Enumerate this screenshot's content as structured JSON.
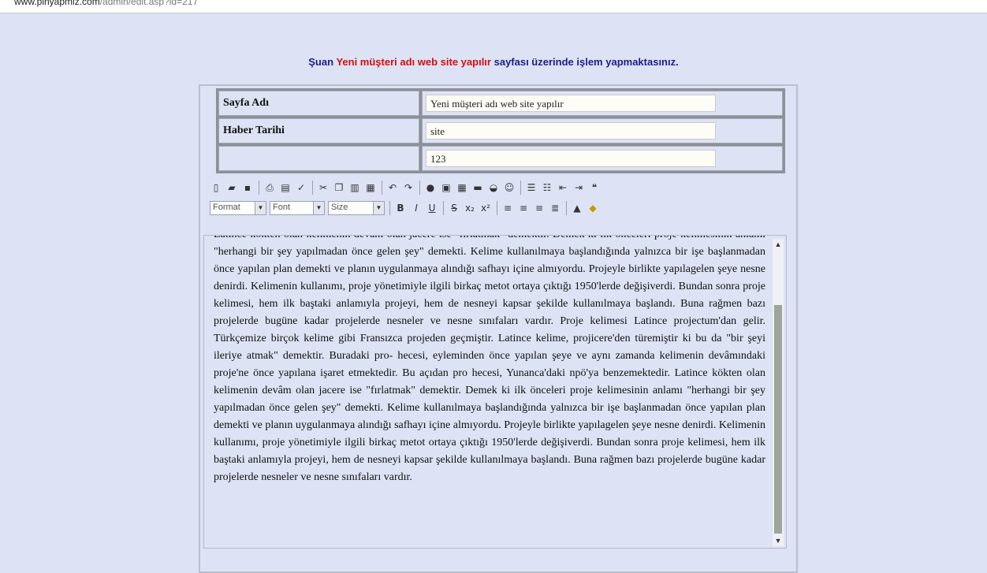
{
  "browser": {
    "url_host": "www.pinyapmiz.com",
    "url_path": "/admin/edit.asp?id=217"
  },
  "heading": {
    "prefix": "Şuan",
    "page_name": "Yeni müşteri adı web site yapılır",
    "suffix": "sayfası üzerinde işlem yapmaktasınız."
  },
  "form": {
    "rows": [
      {
        "label": "Sayfa Adı",
        "value": "Yeni müşteri adı web site yapılır"
      },
      {
        "label": "Haber Tarihi",
        "value": "site"
      },
      {
        "label": "",
        "value": "123"
      }
    ]
  },
  "toolbar": {
    "row1_icons": [
      "new-document-icon",
      "open-folder-icon",
      "save-icon",
      "print-icon",
      "preview-icon",
      "spellcheck-icon",
      "cut-icon",
      "copy-icon",
      "paste-icon",
      "paste-word-icon",
      "undo-icon",
      "redo-icon",
      "link-icon",
      "image-icon",
      "table-icon",
      "flash-icon",
      "form-icon",
      "smiley-icon",
      "ordered-list-icon",
      "unordered-list-icon",
      "outdent-icon",
      "indent-icon",
      "blockquote-icon"
    ],
    "format_label": "Format",
    "font_label": "Font",
    "size_label": "Size",
    "row2_icons": [
      "bold-icon",
      "italic-icon",
      "underline-icon",
      "strikethrough-icon",
      "subscript-icon",
      "superscript-icon",
      "align-left-icon",
      "align-center-icon",
      "align-right-icon",
      "align-justify-icon",
      "text-color-icon",
      "background-color-icon"
    ]
  },
  "editor": {
    "content": "Latince kökten olan kelimenin devâm olan jacere ise \"fırlatmak\" demektir. Demek ki ilk önceleri proje kelimesinin anlamı \"herhangi bir şey yapılmadan önce gelen şey\" demekti. Kelime kullanılmaya başlandığında yalnızca bir işe başlanmadan önce yapılan plan demekti ve planın uygulanmaya alındığı safhayı içine almıyordu. Projeyle birlikte yapılagelen şeye nesne denirdi. Kelimenin kullanımı, proje yönetimiyle ilgili birkaç metot ortaya çıktığı 1950'lerde değişiverdi. Bundan sonra proje kelimesi, hem ilk baştaki anlamıyla projeyi, hem de nesneyi kapsar şekilde kullanılmaya başlandı. Buna rağmen bazı projelerde bugüne kadar projelerde nesneler ve nesne sınıfaları vardır. Proje kelimesi Latince projectum'dan gelir. Türkçemize birçok kelime gibi Fransızca projeden geçmiştir. Latince kelime, projicere'den türemiştir ki bu da \"bir şeyi ileriye atmak\" demektir. Buradaki pro- hecesi, eyleminden önce yapılan şeye ve aynı zamanda kelimenin devâmındaki proje'ne önce yapılana işaret etmektedir. Bu açıdan pro hecesi, Yunanca'daki npö'ya benzemektedir. Latince kökten olan kelimenin devâm olan jacere ise \"fırlatmak\" demektir. Demek ki ilk önceleri proje kelimesinin anlamı \"herhangi bir şey yapılmadan önce gelen şey\" demekti. Kelime kullanılmaya başlandığında yalnızca bir işe başlanmadan önce yapılan plan demekti ve planın uygulanmaya alındığı safhayı içine almıyordu. Projeyle birlikte yapılagelen şeye nesne denirdi. Kelimenin kullanımı, proje yönetimiyle ilgili birkaç metot ortaya çıktığı 1950'lerde değişiverdi. Bundan sonra proje kelimesi, hem ilk baştaki anlamıyla projeyi, hem de nesneyi kapsar şekilde kullanılmaya başlandı. Buna rağmen bazı projelerde bugüne kadar projelerde nesneler ve nesne sınıfaları vardır."
  },
  "colors": {
    "page_bg": "#dde3f4",
    "heading_blue": "#1c1c8c",
    "heading_red": "#d20e0e"
  }
}
